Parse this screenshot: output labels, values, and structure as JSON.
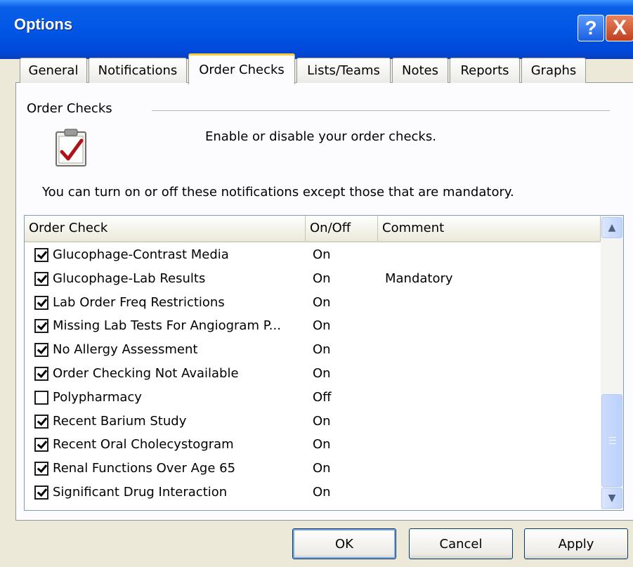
{
  "window": {
    "title": "Options",
    "help_label": "?",
    "close_label": "X"
  },
  "tabs": [
    {
      "label": "General",
      "active": false
    },
    {
      "label": "Notifications",
      "active": false
    },
    {
      "label": "Order Checks",
      "active": true
    },
    {
      "label": "Lists/Teams",
      "active": false
    },
    {
      "label": "Notes",
      "active": false
    },
    {
      "label": "Reports",
      "active": false
    },
    {
      "label": "Graphs",
      "active": false
    }
  ],
  "panel": {
    "group_label": "Order Checks",
    "icon": "clipboard-check-icon",
    "description": "Enable or disable your order checks.",
    "info": "You can turn on or off these notifications except those that are mandatory."
  },
  "list": {
    "columns": [
      "Order Check",
      "On/Off",
      "Comment"
    ],
    "rows": [
      {
        "name": "Glucophage-Contrast Media",
        "state": "On",
        "comment": "",
        "checked": true
      },
      {
        "name": "Glucophage-Lab Results",
        "state": "On",
        "comment": "Mandatory",
        "checked": true
      },
      {
        "name": "Lab Order Freq Restrictions",
        "state": "On",
        "comment": "",
        "checked": true
      },
      {
        "name": "Missing Lab Tests For Angiogram P...",
        "state": "On",
        "comment": "",
        "checked": true
      },
      {
        "name": "No Allergy Assessment",
        "state": "On",
        "comment": "",
        "checked": true
      },
      {
        "name": "Order Checking Not Available",
        "state": "On",
        "comment": "",
        "checked": true
      },
      {
        "name": "Polypharmacy",
        "state": "Off",
        "comment": "",
        "checked": false
      },
      {
        "name": "Recent Barium Study",
        "state": "On",
        "comment": "",
        "checked": true
      },
      {
        "name": "Recent Oral Cholecystogram",
        "state": "On",
        "comment": "",
        "checked": true
      },
      {
        "name": "Renal Functions Over Age 65",
        "state": "On",
        "comment": "",
        "checked": true
      },
      {
        "name": "Significant Drug Interaction",
        "state": "On",
        "comment": "",
        "checked": true
      }
    ]
  },
  "buttons": {
    "ok": "OK",
    "cancel": "Cancel",
    "apply": "Apply"
  },
  "colors": {
    "titlebar": "#0055E5",
    "active_tab_accent": "#FFC83C",
    "dialog_bg": "#ECE9D8"
  }
}
